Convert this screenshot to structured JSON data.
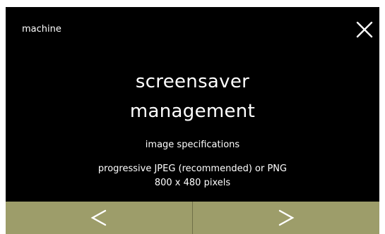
{
  "header": {
    "breadcrumb": "machine",
    "close_icon": "close-icon"
  },
  "main": {
    "title_line1": "screensaver",
    "title_line2": "management",
    "subtitle": "image specifications",
    "spec_line1": "progressive JPEG (recommended) or PNG",
    "spec_line2": "800 x 480 pixels"
  },
  "navbar": {
    "prev_icon": "chevron-left-icon",
    "next_icon": "chevron-right-icon"
  },
  "colors": {
    "background": "#000000",
    "text": "#ffffff",
    "navbar": "#9d9d6a"
  }
}
